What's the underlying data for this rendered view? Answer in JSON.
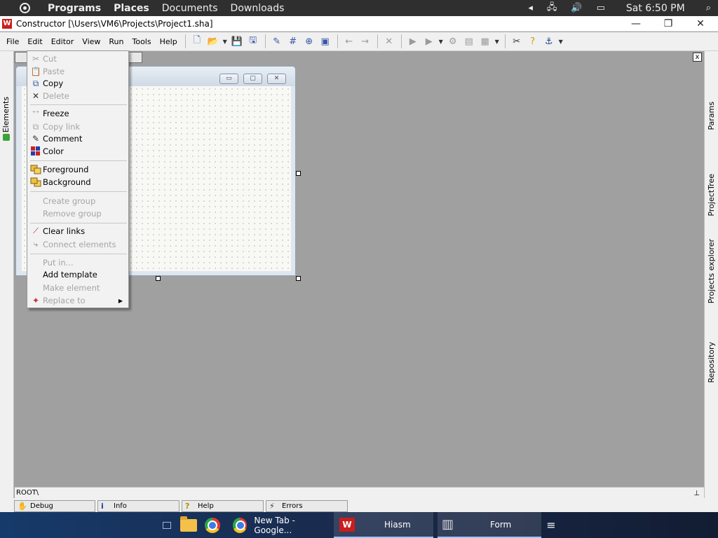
{
  "top_panel": {
    "menus": [
      "Programs",
      "Places",
      "Documents",
      "Downloads"
    ],
    "clock": "Sat 6:50 PM",
    "icons": [
      "volume-arrow-icon",
      "network-icon",
      "speaker-icon",
      "chat-icon",
      "search-icon"
    ]
  },
  "window": {
    "title": "Constructor [\\Users\\VM6\\Projects\\Project1.sha]",
    "app_icon_letter": "W",
    "minimize": "—",
    "maximize": "❐",
    "close": "✕"
  },
  "menubar": {
    "items": [
      "File",
      "Edit",
      "Editor",
      "View",
      "Run",
      "Tools",
      "Help"
    ]
  },
  "side_tabs": {
    "left": [
      "Elements"
    ],
    "right": [
      "Params",
      "ProjectTree",
      "Projects explorer",
      "Repository"
    ]
  },
  "context_menu": {
    "items": [
      {
        "label": "Cut",
        "disabled": true,
        "icon": "scissors-icon"
      },
      {
        "label": "Paste",
        "disabled": true,
        "icon": "paste-icon"
      },
      {
        "label": "Copy",
        "disabled": false,
        "icon": "copy-icon"
      },
      {
        "label": "Delete",
        "disabled": true,
        "icon": "delete-icon"
      },
      {
        "label": "Freeze",
        "disabled": false,
        "icon": "freeze-icon"
      },
      {
        "label": "Copy link",
        "disabled": true,
        "icon": "copy-link-icon"
      },
      {
        "label": "Comment",
        "disabled": false,
        "icon": "comment-icon"
      },
      {
        "label": "Color",
        "disabled": false,
        "icon": "color-icon"
      },
      {
        "label": "Foreground",
        "disabled": false,
        "icon": "foreground-icon"
      },
      {
        "label": "Background",
        "disabled": false,
        "icon": "background-icon"
      },
      {
        "label": "Create group",
        "disabled": true,
        "icon": ""
      },
      {
        "label": "Remove group",
        "disabled": true,
        "icon": ""
      },
      {
        "label": "Clear links",
        "disabled": false,
        "icon": "clear-links-icon"
      },
      {
        "label": "Connect elements",
        "disabled": true,
        "icon": "connect-elements-icon"
      },
      {
        "label": "Put in...",
        "disabled": true,
        "icon": ""
      },
      {
        "label": "Add template",
        "disabled": false,
        "icon": ""
      },
      {
        "label": "Make element",
        "disabled": true,
        "icon": ""
      },
      {
        "label": "Replace to",
        "disabled": true,
        "icon": "replace-icon"
      }
    ]
  },
  "path_bar": {
    "path": "ROOT\\"
  },
  "bottom_tabs": [
    {
      "label": "Debug",
      "icon": "hand-icon"
    },
    {
      "label": "Info",
      "icon": "info-icon"
    },
    {
      "label": "Help",
      "icon": "help-icon"
    },
    {
      "label": "Errors",
      "icon": "errors-icon"
    }
  ],
  "taskbar": {
    "items": [
      {
        "label": "",
        "icon": "desktop-icon"
      },
      {
        "label": "",
        "icon": "file-manager-icon"
      },
      {
        "label": "",
        "icon": "chrome-icon"
      },
      {
        "label": "New Tab - Google...",
        "icon": "chrome-icon"
      },
      {
        "label": "Hiasm",
        "icon": "hiasm-icon"
      },
      {
        "label": "Form",
        "icon": "form-icon"
      },
      {
        "label": "",
        "icon": "menu-icon"
      }
    ]
  },
  "colors": {
    "taskbar": "#1c2f52",
    "top_panel": "#2f2f2f",
    "workarea": "#a0a0a0",
    "menu_bg": "#f2f2f2",
    "disabled_text": "#a5a5a5"
  }
}
